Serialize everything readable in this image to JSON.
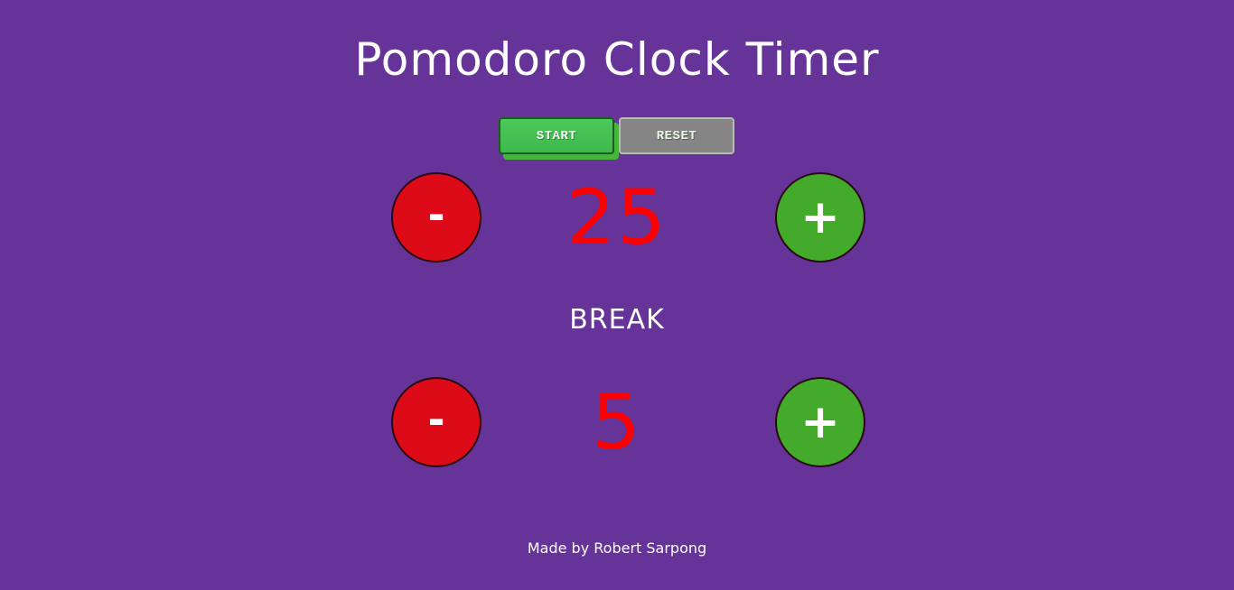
{
  "header": {
    "title": "Pomodoro Clock Timer"
  },
  "controls": {
    "start_label": "START",
    "reset_label": "RESET"
  },
  "session": {
    "minus_label": "-",
    "value": "25",
    "plus_label": "+"
  },
  "break": {
    "label": "BREAK",
    "minus_label": "-",
    "value": "5",
    "plus_label": "+"
  },
  "footer": {
    "credit": "Made by Robert Sarpong"
  },
  "colors": {
    "background": "#663399",
    "minus_button": "#dd0a18",
    "plus_button": "#44aa2b",
    "value_text": "#ff0000",
    "start_button": "#45c052",
    "reset_button": "#858585"
  },
  "icons": {
    "minus": "minus-icon",
    "plus": "plus-icon"
  }
}
